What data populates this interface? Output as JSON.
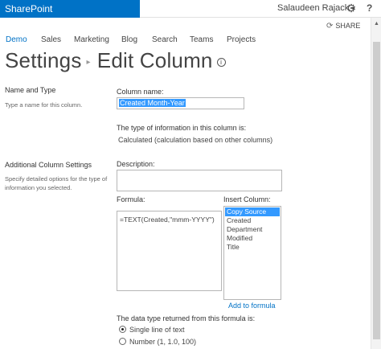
{
  "suite": {
    "brand": "SharePoint",
    "user": "Salaudeen Rajack",
    "user_caret": "▾",
    "gear_icon": "⚙",
    "help_icon": "?"
  },
  "share": {
    "icon": "share-icon",
    "label": "SHARE"
  },
  "nav": {
    "items": [
      "Demo",
      "Sales",
      "Marketing",
      "Blog",
      "Search",
      "Teams",
      "Projects"
    ],
    "active_color": "#0072c6"
  },
  "page": {
    "title_root": "Settings",
    "title_sep": "▸",
    "title_page": "Edit Column",
    "info_icon": "i"
  },
  "left": {
    "name_type_title": "Name and Type",
    "name_type_desc": "Type a name for this column.",
    "additional_title": "Additional Column Settings",
    "additional_desc": "Specify detailed options for the type of information you selected."
  },
  "form": {
    "column_name_label": "Column name:",
    "column_name_value": "Created Month-Year",
    "type_label": "The type of information in this column is:",
    "type_value": "Calculated (calculation based on other columns)",
    "description_label": "Description:",
    "description_value": "",
    "formula_label": "Formula:",
    "formula_value": "=TEXT(Created,\"mmm-YYYY\")",
    "insert_label": "Insert Column:",
    "insert_items": [
      "Copy Source",
      "Created",
      "Department",
      "Modified",
      "Title"
    ],
    "add_to_formula": "Add to formula",
    "return_label": "The data type returned from this formula is:",
    "return_options": [
      "Single line of text",
      "Number (1, 1.0, 100)"
    ],
    "return_selected": "Single line of text"
  },
  "colors": {
    "brand": "#0072c6",
    "selection": "#3399ff"
  }
}
